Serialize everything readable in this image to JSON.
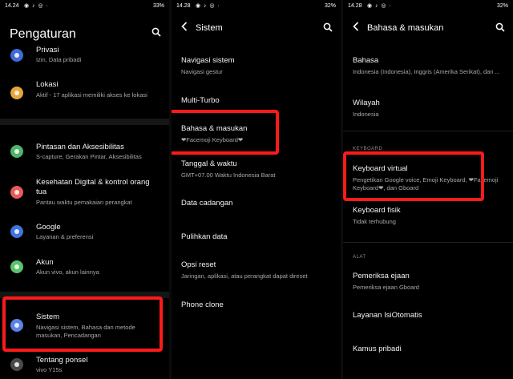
{
  "panel1": {
    "status": {
      "time": "14.24",
      "right": "33%"
    },
    "title": "Pengaturan",
    "items": [
      {
        "title": "Privasi",
        "subtitle": "Izin, Data pribadi",
        "color": "#3d6bd8"
      },
      {
        "title": "Lokasi",
        "subtitle": "Aktif - 17 aplikasi memiliki akses ke lokasi",
        "color": "#e8a53a"
      },
      {
        "title": "Pintasan dan Aksesibilitas",
        "subtitle": "S-capture, Gerakan Pintar, Aksesibilitas",
        "color": "#4fb36a"
      },
      {
        "title": "Kesehatan Digital & kontrol orang tua",
        "subtitle": "Pantau waktu pemakaian perangkat",
        "color": "#e85a5a"
      },
      {
        "title": "Google",
        "subtitle": "Layanan & preferensi",
        "color": "#3f73e0"
      },
      {
        "title": "Akun",
        "subtitle": "Akun vivo, akun lainnya",
        "color": "#5bc46a"
      },
      {
        "title": "Sistem",
        "subtitle": "Navigasi sistem, Bahasa dan metode masukan, Pencadangan",
        "color": "#5a82e8"
      },
      {
        "title": "Tentang ponsel",
        "subtitle": "vivo Y15s",
        "color": "#4a4a4a"
      }
    ]
  },
  "panel2": {
    "status": {
      "time": "14.28",
      "right": "32%"
    },
    "title": "Sistem",
    "items": [
      {
        "title": "Navigasi sistem",
        "subtitle": "Navigasi gestur"
      },
      {
        "title": "Multi-Turbo",
        "subtitle": ""
      },
      {
        "title": "Bahasa & masukan",
        "subtitle": "❤Facemoji Keyboard❤"
      },
      {
        "title": "Tanggal & waktu",
        "subtitle": "GMT+07.00 Waktu Indonesia Barat"
      },
      {
        "title": "Data cadangan",
        "subtitle": ""
      },
      {
        "title": "Pulihkan data",
        "subtitle": ""
      },
      {
        "title": "Opsi reset",
        "subtitle": "Jaringan, aplikasi, atau perangkat dapat direset"
      },
      {
        "title": "Phone clone",
        "subtitle": ""
      }
    ]
  },
  "panel3": {
    "status": {
      "time": "14.28",
      "right": "32%"
    },
    "title": "Bahasa & masukan",
    "items": [
      {
        "title": "Bahasa",
        "subtitle": "Indonesia (Indonesia), Inggris (Amerika Serikat), dan ..."
      },
      {
        "title": "Wilayah",
        "subtitle": "Indonesia"
      },
      {
        "title": "Keyboard virtual",
        "subtitle": "Pengetikan Google voice, Emoji Keyboard, ❤Facemoji Keyboard❤, dan Gboard"
      },
      {
        "title": "Keyboard fisik",
        "subtitle": "Tidak terhubung"
      },
      {
        "title": "Pemeriksa ejaan",
        "subtitle": "Pemeriksa ejaan Gboard"
      },
      {
        "title": "Layanan IsiOtomatis",
        "subtitle": ""
      },
      {
        "title": "Kamus pribadi",
        "subtitle": ""
      }
    ],
    "categories": {
      "keyboard": "KEYBOARD",
      "alat": "ALAT"
    }
  },
  "colors": {
    "highlight": "#ff1a1a",
    "background": "#000000"
  },
  "icons": {
    "search": "search-icon",
    "back": "back-arrow-icon"
  }
}
